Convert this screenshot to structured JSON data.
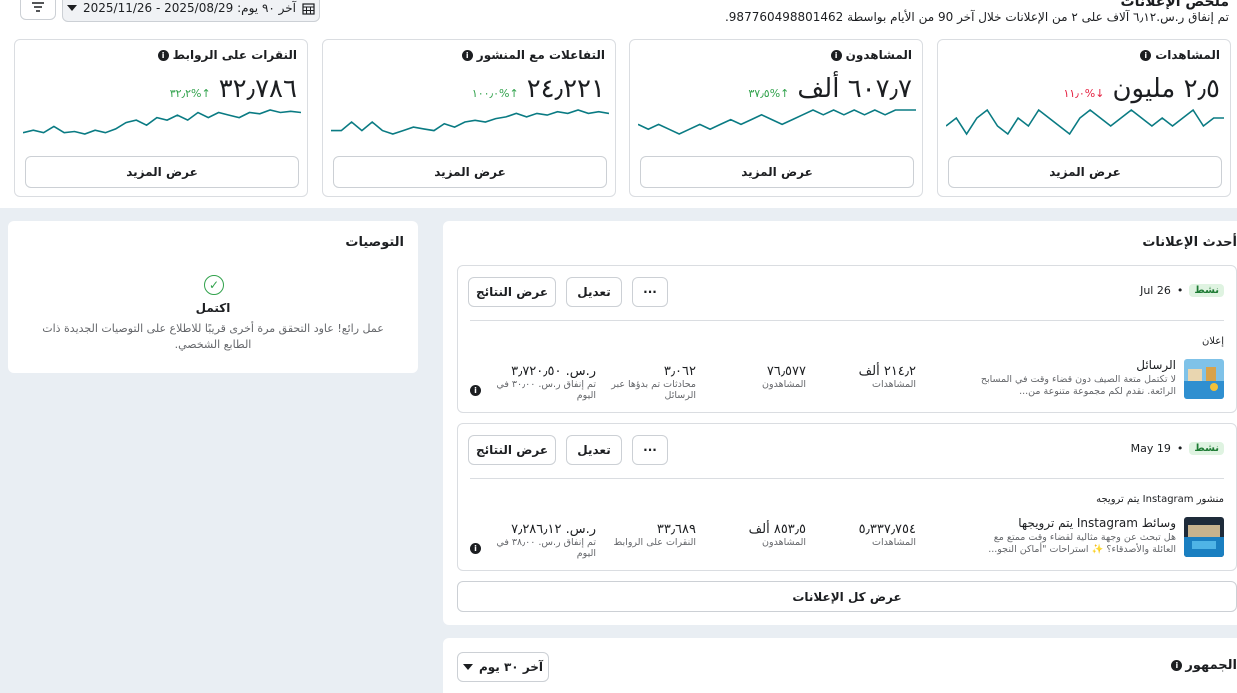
{
  "summary": {
    "title": "ملخص الإعلانات",
    "subtitle": "تم إنفاق ر.س.٦٫١٢ آلاف على ٢ من الإعلانات خلال آخر 90 من الأيام بواسطة 987760498801462."
  },
  "toolbar": {
    "date_range_label": "آخر ٩٠ يوم: 2025/08/29 - 2025/11/26",
    "icons": [
      "filter-icon",
      "calendar-icon",
      "caret-down-icon"
    ]
  },
  "metrics": [
    {
      "title": "المشاهدات",
      "value": "٢٫٥ مليون",
      "change": "%١١٫٠",
      "direction": "down",
      "more_label": "عرض المزيد",
      "spark": [
        5,
        6,
        4,
        6,
        7,
        5,
        4,
        6,
        5,
        7,
        6,
        5,
        4,
        6,
        7,
        6,
        5,
        6,
        7,
        6,
        5,
        6,
        5,
        6,
        7,
        5,
        6,
        6
      ]
    },
    {
      "title": "المشاهدون",
      "value": "٦٠٧٫٧ ألف",
      "change": "%٣٧٫٥",
      "direction": "up",
      "more_label": "عرض المزيد",
      "spark": [
        5,
        4,
        5,
        4,
        3,
        4,
        5,
        4,
        5,
        6,
        5,
        6,
        7,
        6,
        5,
        6,
        7,
        8,
        7,
        8,
        7,
        8,
        7,
        8,
        7,
        8,
        8,
        8
      ]
    },
    {
      "title": "التفاعلات مع المنشور",
      "value": "٢٤٫٢٢١",
      "change": "%١٠٠٫٠",
      "direction": "up",
      "more_label": "عرض المزيد",
      "spark": [
        3,
        3,
        3.5,
        3,
        3.5,
        3,
        2.8,
        3,
        3.2,
        3.1,
        3,
        3.4,
        3.2,
        3.5,
        3.6,
        3.5,
        3.7,
        3.8,
        4,
        3.8,
        4,
        3.9,
        4.1,
        4,
        4.2,
        4,
        4.1,
        4
      ]
    },
    {
      "title": "النقرات على الروابط",
      "value": "٣٢٫٧٨٦",
      "change": "%٣٢٫٢",
      "direction": "up",
      "more_label": "عرض المزيد",
      "spark": [
        4,
        4.2,
        4,
        4.5,
        4,
        4.1,
        3.9,
        4.2,
        4,
        4.3,
        4.8,
        5,
        4.6,
        5.2,
        5,
        5.4,
        5,
        5.6,
        5.2,
        5.6,
        5.4,
        5.2,
        5.6,
        5.5,
        5.8,
        5.6,
        5.7,
        5.6
      ]
    }
  ],
  "recommendations": {
    "title": "التوصيات",
    "status": "اكتمل",
    "text": "عمل رائع! عاود التحقق مرة أخرى قريبًا للاطلاع على التوصيات الجديدة ذات الطابع الشخصي.",
    "icon": "check-circle-icon"
  },
  "recent_ads": {
    "title": "أحدث الإعلانات",
    "view_all_label": "عرض كل الإعلانات",
    "items": [
      {
        "status": "نشط",
        "date": "Jul 26",
        "type_label": "إعلان",
        "name": "الرسائل",
        "description": "لا تكتمل متعة الصيف دون قضاء وقت في المسابح الرائعة. نقدم لكم مجموعة متنوعة من...",
        "stats": [
          {
            "value": "٢١٤٫٢ ألف",
            "label": "المشاهدات"
          },
          {
            "value": "٧٦٫٥٧٧",
            "label": "المشاهدون"
          },
          {
            "value": "٣٫٠٦٢",
            "label": "محادثات تم بدؤها عبر الرسائل"
          }
        ],
        "spend": "ر.س. ٣٫٧٢٠٫٥٠",
        "spend_note": "تم إنفاق ر.س. ٣٠٫٠٠ في اليوم",
        "actions": {
          "results": "عرض النتائج",
          "edit": "تعديل",
          "more": "···"
        }
      },
      {
        "status": "نشط",
        "date": "May 19",
        "type_label": "منشور Instagram يتم ترويجه",
        "name": "وسائط Instagram يتم ترويجها",
        "description": "هل تبحث عن وجهة مثالية لقضاء وقت ممتع مع العائلة والأصدقاء؟ ✨ استراحات \"أماكن النجو...",
        "stats": [
          {
            "value": "٥٫٣٣٧٫٧٥٤",
            "label": "المشاهدات"
          },
          {
            "value": "٨٥٣٫٥ ألف",
            "label": "المشاهدون"
          },
          {
            "value": "٣٣٫٦٨٩",
            "label": "النقرات على الروابط"
          }
        ],
        "spend": "ر.س. ٧٫٢٨٦٫١٢",
        "spend_note": "تم إنفاق ر.س. ٣٨٫٠٠ في اليوم",
        "actions": {
          "results": "عرض النتائج",
          "edit": "تعديل",
          "more": "···"
        }
      }
    ]
  },
  "audience": {
    "title": "الجمهور",
    "range_label": "آخر ٣٠ يوم"
  },
  "colors": {
    "up": "#31a24c",
    "down": "#e41e3f",
    "spark": "#0a7b83",
    "border": "#dadde1"
  }
}
